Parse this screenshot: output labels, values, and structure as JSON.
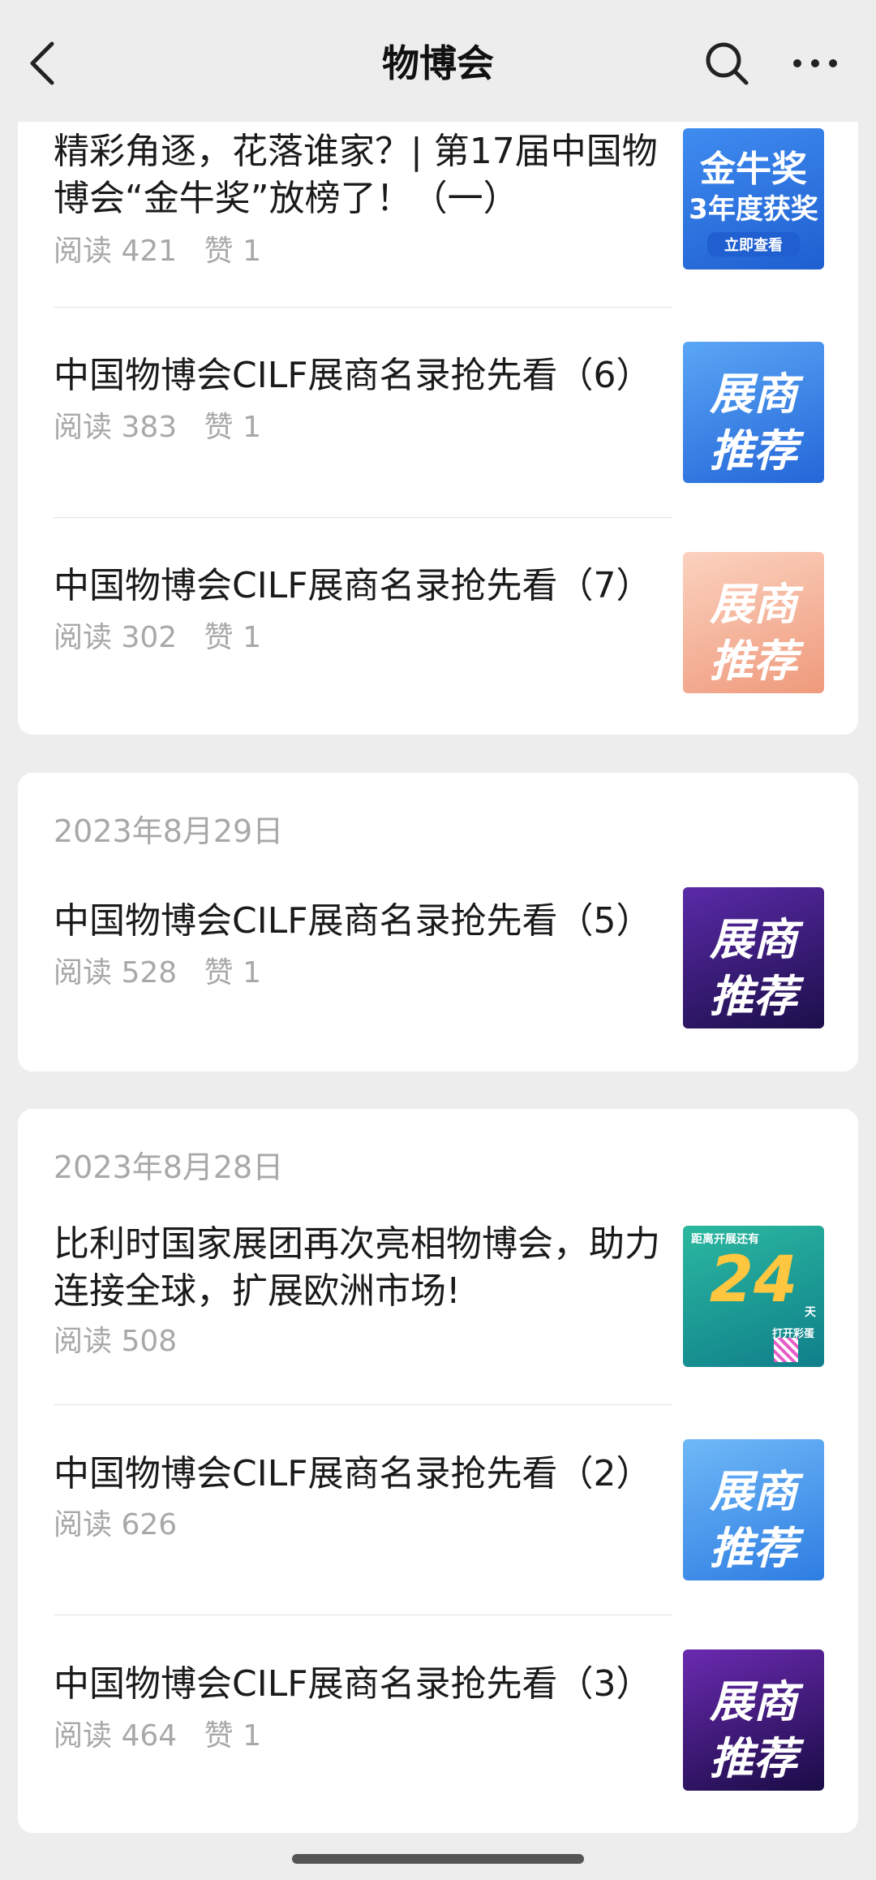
{
  "header": {
    "title": "物博会"
  },
  "icons": {
    "back": "chevron-left-icon",
    "search": "search-icon",
    "more": "more-dots-icon"
  },
  "colors": {
    "page_bg": "#ededed",
    "card_bg": "#ffffff",
    "secondary_text": "#a8a8a8"
  },
  "groups": [
    {
      "date": "",
      "articles": [
        {
          "title": "精彩角逐，花落谁家？| 第17届中国物博会“金牛奖”放榜了！（一）",
          "reads": "阅读 421",
          "likes": "赞 1",
          "thumb_lines": [
            "金牛奖",
            "3年度获奖",
            "立即查看"
          ],
          "thumb_color": "#2f78e4"
        },
        {
          "title": "中国物博会CILF展商名录抢先看（6）",
          "reads": "阅读 383",
          "likes": "赞 1",
          "thumb_lines": [
            "展商",
            "推荐"
          ],
          "thumb_color": "#3a86e8"
        },
        {
          "title": "中国物博会CILF展商名录抢先看（7）",
          "reads": "阅读 302",
          "likes": "赞 1",
          "thumb_lines": [
            "展商",
            "推荐"
          ],
          "thumb_color": "#f3a98c"
        }
      ]
    },
    {
      "date": "2023年8月29日",
      "articles": [
        {
          "title": "中国物博会CILF展商名录抢先看（5）",
          "reads": "阅读 528",
          "likes": "赞 1",
          "thumb_lines": [
            "展商",
            "推荐"
          ],
          "thumb_color": "#3a1a7a"
        }
      ]
    },
    {
      "date": "2023年8月28日",
      "articles": [
        {
          "title": "比利时国家展团再次亮相物博会，助力连接全球，扩展欧洲市场!",
          "reads": "阅读 508",
          "likes": "",
          "thumb_lines": [
            "距离开展还有",
            "24",
            "天",
            "打开彩蛋"
          ],
          "thumb_color": "#1aa58f"
        },
        {
          "title": "中国物博会CILF展商名录抢先看（2）",
          "reads": "阅读 626",
          "likes": "",
          "thumb_lines": [
            "展商",
            "推荐"
          ],
          "thumb_color": "#3a8ee8"
        },
        {
          "title": "中国物博会CILF展商名录抢先看（3）",
          "reads": "阅读 464",
          "likes": "赞 1",
          "thumb_lines": [
            "展商",
            "推荐"
          ],
          "thumb_color": "#3a1a7a"
        }
      ]
    }
  ]
}
